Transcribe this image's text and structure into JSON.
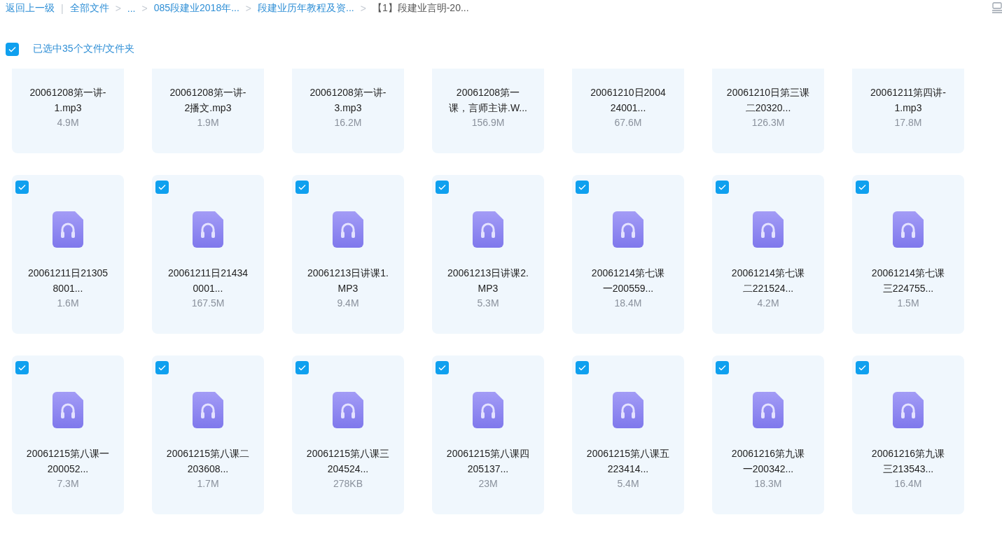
{
  "breadcrumb": {
    "back": "返回上一级",
    "divider": "|",
    "items": [
      {
        "label": "全部文件",
        "current": false
      },
      {
        "separator": ">",
        "label": "...",
        "current": false
      },
      {
        "separator": ">",
        "label": "085段建业2018年...",
        "current": false
      },
      {
        "separator": ">",
        "label": "段建业历年教程及资...",
        "current": false
      },
      {
        "separator": ">",
        "label": "【1】段建业言明-20...",
        "current": true
      }
    ]
  },
  "selection": {
    "checked": true,
    "label": "已选中35个文件/文件夹"
  },
  "files": [
    {
      "name_lines": [
        "20061208第一讲-",
        "1.mp3"
      ],
      "size": "4.9M"
    },
    {
      "name_lines": [
        "20061208第一讲-",
        "2播文.mp3"
      ],
      "size": "1.9M"
    },
    {
      "name_lines": [
        "20061208第一讲-",
        "3.mp3"
      ],
      "size": "16.2M"
    },
    {
      "name_lines": [
        "20061208第一",
        "课，言师主讲.W..."
      ],
      "size": "156.9M"
    },
    {
      "name_lines": [
        "20061210日2004",
        "24001..."
      ],
      "size": "67.6M"
    },
    {
      "name_lines": [
        "20061210日第三课",
        "二20320..."
      ],
      "size": "126.3M"
    },
    {
      "name_lines": [
        "20061211第四讲-",
        "1.mp3"
      ],
      "size": "17.8M"
    },
    {
      "name_lines": [
        "20061211日21305",
        "8001..."
      ],
      "size": "1.6M",
      "selected": true
    },
    {
      "name_lines": [
        "20061211日21434",
        "0001..."
      ],
      "size": "167.5M",
      "selected": true
    },
    {
      "name_lines": [
        "20061213日讲课1.",
        "MP3"
      ],
      "size": "9.4M",
      "selected": true
    },
    {
      "name_lines": [
        "20061213日讲课2.",
        "MP3"
      ],
      "size": "5.3M",
      "selected": true
    },
    {
      "name_lines": [
        "20061214第七课",
        "一200559..."
      ],
      "size": "18.4M",
      "selected": true
    },
    {
      "name_lines": [
        "20061214第七课",
        "二221524..."
      ],
      "size": "4.2M",
      "selected": true
    },
    {
      "name_lines": [
        "20061214第七课",
        "三224755..."
      ],
      "size": "1.5M",
      "selected": true
    },
    {
      "name_lines": [
        "20061215第八课一",
        "200052..."
      ],
      "size": "7.3M",
      "selected": true
    },
    {
      "name_lines": [
        "20061215第八课二",
        "203608..."
      ],
      "size": "1.7M",
      "selected": true
    },
    {
      "name_lines": [
        "20061215第八课三",
        "204524..."
      ],
      "size": "278KB",
      "selected": true
    },
    {
      "name_lines": [
        "20061215第八课四",
        "205137..."
      ],
      "size": "23M",
      "selected": true
    },
    {
      "name_lines": [
        "20061215第八课五",
        "223414..."
      ],
      "size": "5.4M",
      "selected": true
    },
    {
      "name_lines": [
        "20061216第九课",
        "一200342..."
      ],
      "size": "18.3M",
      "selected": true
    },
    {
      "name_lines": [
        "20061216第九课",
        "三213543..."
      ],
      "size": "16.4M",
      "selected": true
    }
  ]
}
